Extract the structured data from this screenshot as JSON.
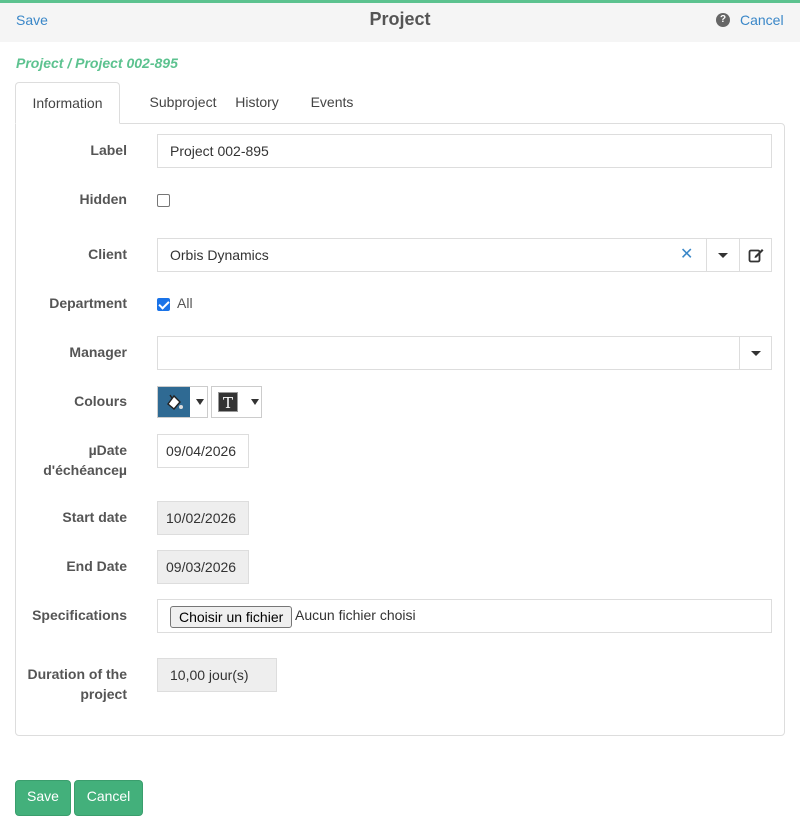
{
  "header": {
    "save_label": "Save",
    "title": "Project",
    "help_glyph": "?",
    "cancel_label": "Cancel"
  },
  "breadcrumb": "Project / Project 002-895",
  "tabs": [
    {
      "label": "Information",
      "active": true
    },
    {
      "label": "Subproject",
      "active": false
    },
    {
      "label": "History",
      "active": false
    },
    {
      "label": "Events",
      "active": false
    }
  ],
  "form": {
    "label": {
      "label": "Label",
      "value": "Project 002-895"
    },
    "hidden": {
      "label": "Hidden",
      "checked": false
    },
    "client": {
      "label": "Client",
      "value": "Orbis Dynamics",
      "clear_glyph": "✕"
    },
    "department": {
      "label": "Department",
      "checked": true,
      "option": "All"
    },
    "manager": {
      "label": "Manager",
      "value": ""
    },
    "colours": {
      "label": "Colours",
      "background_colour": "#2f6a93",
      "text_glyph": "T"
    },
    "due_date": {
      "label_line1": "µDate",
      "label_line2": "d'échéanceµ",
      "value": "09/04/2026"
    },
    "start_date": {
      "label": "Start date",
      "value": "10/02/2026"
    },
    "end_date": {
      "label": "End Date",
      "value": "09/03/2026"
    },
    "specifications": {
      "label": "Specifications",
      "button_label": "Choisir un fichier",
      "status": "Aucun fichier choisi"
    },
    "duration": {
      "label_line1": "Duration of the",
      "label_line2": "project",
      "value": "10,00 jour(s)"
    }
  },
  "footer": {
    "save_label": "Save",
    "cancel_label": "Cancel"
  },
  "colors": {
    "accent": "#5cc28f",
    "link": "#3a87c8",
    "button": "#43b07b"
  }
}
